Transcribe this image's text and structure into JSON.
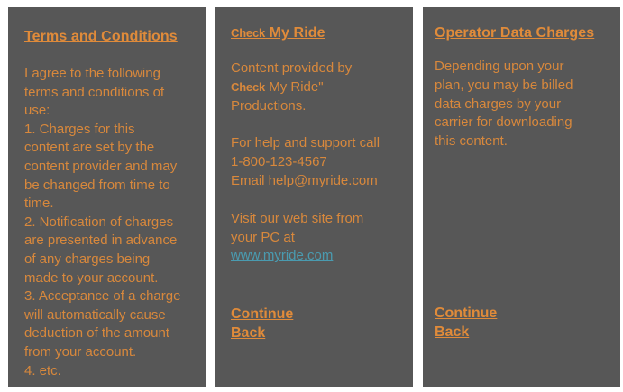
{
  "terms_screen": {
    "title": "Terms and Conditions",
    "body": "I agree to the following\nterms and conditions of\nuse:\n1. Charges for this\ncontent are set by the\ncontent provider and may\nbe changed from time to\ntime.\n2. Notification of charges\nare presented in advance\nof any charges being\nmade to your account.\n3. Acceptance of a charge\nwill automatically cause\ndeduction of the amount\nfrom your account.\n4. etc."
  },
  "about_screen": {
    "title_bold": "Check",
    "title_rest": " My Ride",
    "content_line1": "Content provided by",
    "content_brand_bold": "Check",
    "content_brand_rest": " My Ride\"",
    "content_line3": "Productions.",
    "support_text": "For help and support call\n1-800-123-4567\nEmail help@myride.com",
    "visit_text": "Visit our web site from\nyour PC at",
    "website_link": "www.myride.com",
    "continue_label": "Continue",
    "back_label": "Back"
  },
  "charges_screen": {
    "title": "Operator Data Charges",
    "body": "Depending upon your\nplan, you may be billed\ndata charges by your\ncarrier for downloading\nthis content.",
    "continue_label": "Continue",
    "back_label": "Back"
  }
}
